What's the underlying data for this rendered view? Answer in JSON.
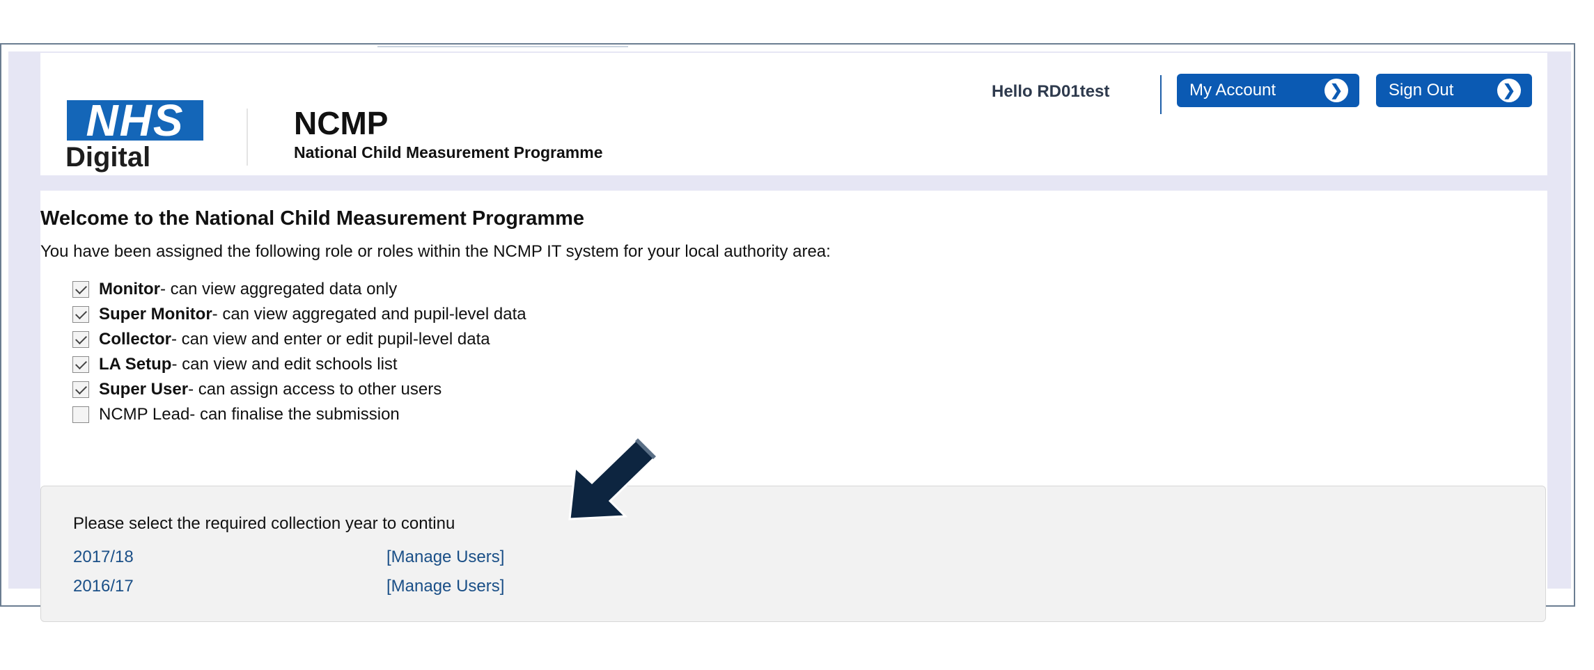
{
  "header": {
    "logo": {
      "wordmark": "NHS",
      "subtext": "Digital"
    },
    "title": "NCMP",
    "subtitle": "National Child Measurement Programme",
    "greeting": "Hello RD01test",
    "my_account_label": "My Account",
    "sign_out_label": "Sign Out",
    "button_icon": "chevron-right-circle-icon"
  },
  "main": {
    "welcome": "Welcome to the National Child Measurement Programme",
    "intro": "You have been assigned the following role or roles within the NCMP IT system for your local authority area:",
    "roles": [
      {
        "name": "Monitor",
        "desc": " - can view aggregated data only",
        "checked": true,
        "bold": true
      },
      {
        "name": "Super Monitor",
        "desc": " - can view aggregated and pupil-level data",
        "checked": true,
        "bold": true
      },
      {
        "name": "Collector",
        "desc": " - can view and enter or edit pupil-level data",
        "checked": true,
        "bold": true
      },
      {
        "name": "LA Setup",
        "desc": " - can view and edit schools list",
        "checked": true,
        "bold": true
      },
      {
        "name": "Super User",
        "desc": " - can assign access to other users",
        "checked": true,
        "bold": true
      },
      {
        "name": "NCMP Lead",
        "desc": " - can finalise the submission",
        "checked": false,
        "bold": false
      }
    ],
    "panel": {
      "prompt": "Please select the required collection year to continu",
      "years": [
        {
          "year": "2017/18",
          "manage": "[Manage Users]"
        },
        {
          "year": "2016/17",
          "manage": "[Manage Users]"
        }
      ]
    }
  },
  "colors": {
    "brand_blue": "#0b5ab3",
    "nhs_blue": "#1466b8",
    "link": "#1a4f87",
    "page_bg": "#e6e6f4"
  },
  "annotation": {
    "icon": "pointer-arrow-icon"
  }
}
